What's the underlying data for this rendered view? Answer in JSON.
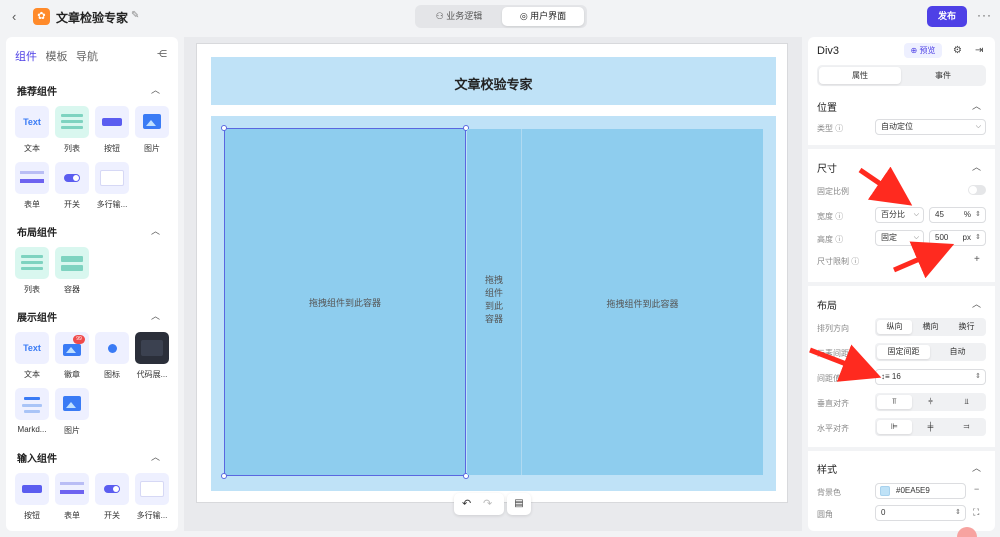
{
  "topbar": {
    "back_icon": "chevron-left-icon",
    "app_title": "文章检验专家",
    "tabs": [
      {
        "label": "业务逻辑",
        "icon": "flow-icon"
      },
      {
        "label": "用户界面",
        "icon": "palette-icon"
      }
    ],
    "publish_label": "发布",
    "more_label": "···"
  },
  "left_panel": {
    "tabs": [
      "组件",
      "模板",
      "导航"
    ],
    "sections": [
      {
        "title": "推荐组件",
        "items": [
          "文本",
          "列表",
          "按钮",
          "图片",
          "表单",
          "开关",
          "多行输..."
        ]
      },
      {
        "title": "布局组件",
        "items": [
          "列表",
          "容器"
        ]
      },
      {
        "title": "展示组件",
        "items": [
          "文本",
          "徽章",
          "图标",
          "代码展...",
          "Markd...",
          "图片"
        ]
      },
      {
        "title": "输入组件",
        "items": [
          "按钮",
          "表单",
          "开关",
          "多行输..."
        ]
      }
    ],
    "tile_text": "Text",
    "badge_value": "99"
  },
  "canvas": {
    "header_title": "文章校验专家",
    "col1_placeholder": "拖拽组件到此容器",
    "col2_placeholder": [
      "拖拽",
      "组件",
      "到此",
      "容器"
    ],
    "col3_placeholder": "拖拽组件到此容器"
  },
  "right_panel": {
    "title": "Div3",
    "preview_label": "预览",
    "tabs": [
      "属性",
      "事件"
    ],
    "position": {
      "section": "位置",
      "type_label": "类型",
      "type_value": "自动定位"
    },
    "size": {
      "section": "尺寸",
      "fixed_ratio_label": "固定比例",
      "width_label": "宽度",
      "width_mode": "百分比",
      "width_value": "45",
      "width_unit": "%",
      "height_label": "高度",
      "height_mode": "固定",
      "height_value": "500",
      "height_unit": "px",
      "constraint_label": "尺寸限制",
      "add_label": "+"
    },
    "layout": {
      "section": "布局",
      "direction_label": "排列方向",
      "direction_options": [
        "纵向",
        "横向",
        "换行"
      ],
      "spacing_label": "元素间距",
      "spacing_options": [
        "固定间距",
        "自动"
      ],
      "gap_label": "间距值",
      "gap_value": "16",
      "valign_label": "垂直对齐",
      "halign_label": "水平对齐"
    },
    "style": {
      "section": "样式",
      "bg_label": "背景色",
      "bg_value": "#0EA5E9",
      "radius_label": "圆角",
      "radius_value": "0"
    }
  },
  "colors": {
    "accent": "#4e40e6",
    "container": "#bfe2f7",
    "column": "#8ecdee",
    "arrow": "#ff2a1f"
  }
}
